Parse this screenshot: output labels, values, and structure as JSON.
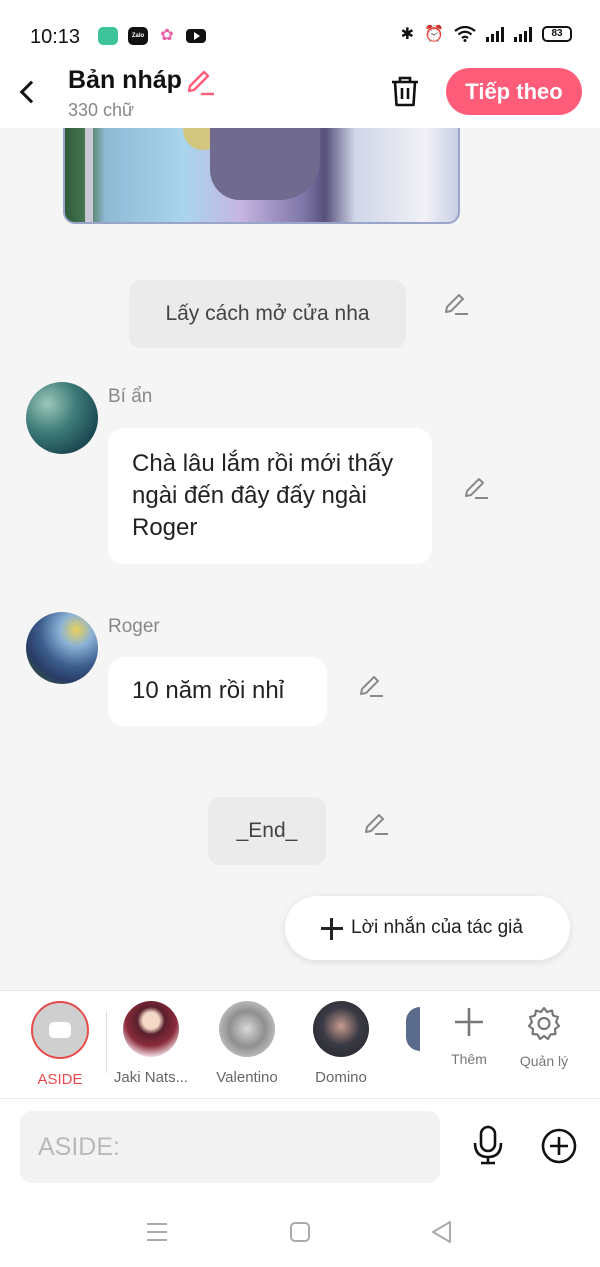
{
  "status_bar": {
    "time": "10:13",
    "apps": [
      "messages-app-icon",
      "zalo-app-icon",
      "photos-app-icon",
      "youtube-app-icon"
    ],
    "zalo_text": "Zalo",
    "battery": "83"
  },
  "header": {
    "title": "Bản nháp",
    "word_count": "330 chữ",
    "next_label": "Tiếp theo",
    "accent_color": "#ff5c7a"
  },
  "chat": {
    "narrations": [
      {
        "text": "Lấy cách mở cửa nha"
      },
      {
        "text": "_End_"
      }
    ],
    "messages": [
      {
        "character": "Bí ẩn",
        "text": "Chà lâu lắm rồi mới thấy ngài đến đây đấy ngài Roger"
      },
      {
        "character": "Roger",
        "text": "10 năm rồi nhỉ"
      }
    ],
    "author_message_label": "Lời nhắn của tác giả"
  },
  "character_bar": {
    "items": [
      {
        "label": "ASIDE",
        "active": true
      },
      {
        "label": "Jaki Nats..."
      },
      {
        "label": "Valentino"
      },
      {
        "label": "Domino"
      }
    ],
    "add_label": "Thêm",
    "manage_label": "Quản lý"
  },
  "input": {
    "placeholder": "ASIDE:"
  }
}
